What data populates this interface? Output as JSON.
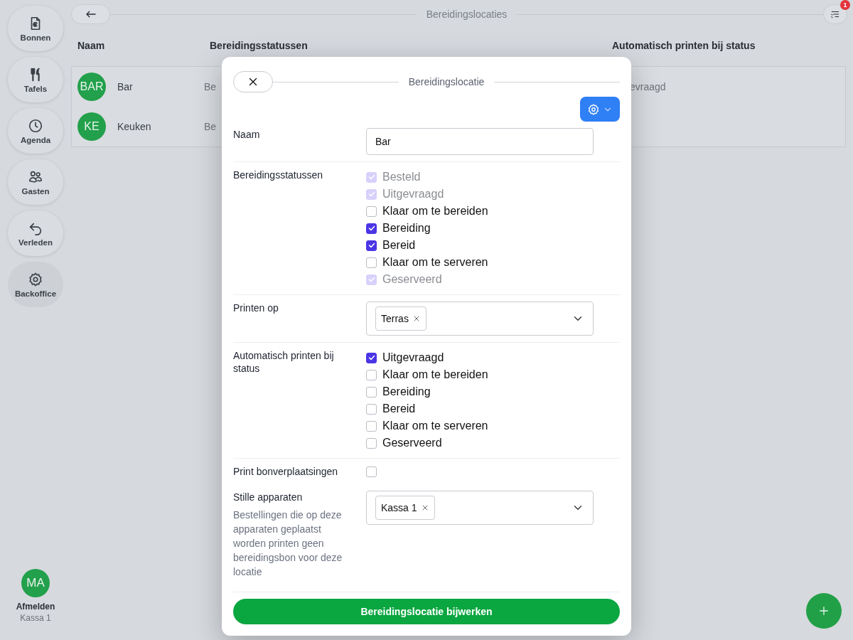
{
  "sidebar": {
    "items": [
      {
        "label": "Bonnen",
        "selected": false
      },
      {
        "label": "Tafels",
        "selected": false
      },
      {
        "label": "Agenda",
        "selected": false
      },
      {
        "label": "Gasten",
        "selected": false
      },
      {
        "label": "Verleden",
        "selected": false
      },
      {
        "label": "Backoffice",
        "selected": true
      }
    ],
    "user": {
      "initials": "MA",
      "action": "Afmelden",
      "device": "Kassa 1"
    }
  },
  "topbar": {
    "title": "Bereidingslocaties",
    "filter_badge": "1"
  },
  "table": {
    "columns": [
      "Naam",
      "Bereidingsstatussen",
      "Automatisch printen bij status"
    ],
    "rows": [
      {
        "initials": "BAR",
        "name": "Bar",
        "statuses": "Be",
        "auto_print": "evraagd"
      },
      {
        "initials": "KE",
        "name": "Keuken",
        "statuses": "Be",
        "auto_print": ""
      }
    ]
  },
  "modal": {
    "title": "Bereidingslocatie",
    "fields": [
      {
        "kind": "text",
        "label": "Naam",
        "value": "Bar"
      },
      {
        "kind": "checklist",
        "label": "Bereidingsstatussen",
        "options": [
          {
            "label": "Besteld",
            "checked": true,
            "disabled": true
          },
          {
            "label": "Uitgevraagd",
            "checked": true,
            "disabled": true
          },
          {
            "label": "Klaar om te bereiden",
            "checked": false,
            "disabled": false
          },
          {
            "label": "Bereiding",
            "checked": true,
            "disabled": false
          },
          {
            "label": "Bereid",
            "checked": true,
            "disabled": false
          },
          {
            "label": "Klaar om te serveren",
            "checked": false,
            "disabled": false
          },
          {
            "label": "Geserveerd",
            "checked": true,
            "disabled": true
          }
        ]
      },
      {
        "kind": "multiselect",
        "label": "Printen op",
        "chips": [
          "Terras"
        ]
      },
      {
        "kind": "checklist",
        "label": "Automatisch printen bij status",
        "options": [
          {
            "label": "Uitgevraagd",
            "checked": true,
            "disabled": false
          },
          {
            "label": "Klaar om te bereiden",
            "checked": false,
            "disabled": false
          },
          {
            "label": "Bereiding",
            "checked": false,
            "disabled": false
          },
          {
            "label": "Bereid",
            "checked": false,
            "disabled": false
          },
          {
            "label": "Klaar om te serveren",
            "checked": false,
            "disabled": false
          },
          {
            "label": "Geserveerd",
            "checked": false,
            "disabled": false
          }
        ]
      },
      {
        "kind": "checkbox",
        "label": "Print bonverplaatsingen",
        "checked": false
      },
      {
        "kind": "multiselect",
        "label": "Stille apparaten",
        "description": "Bestellingen die op deze apparaten geplaatst worden printen geen bereidingsbon voor deze locatie",
        "chips": [
          "Kassa 1"
        ]
      }
    ],
    "submit": "Bereidingslocatie bijwerken"
  }
}
